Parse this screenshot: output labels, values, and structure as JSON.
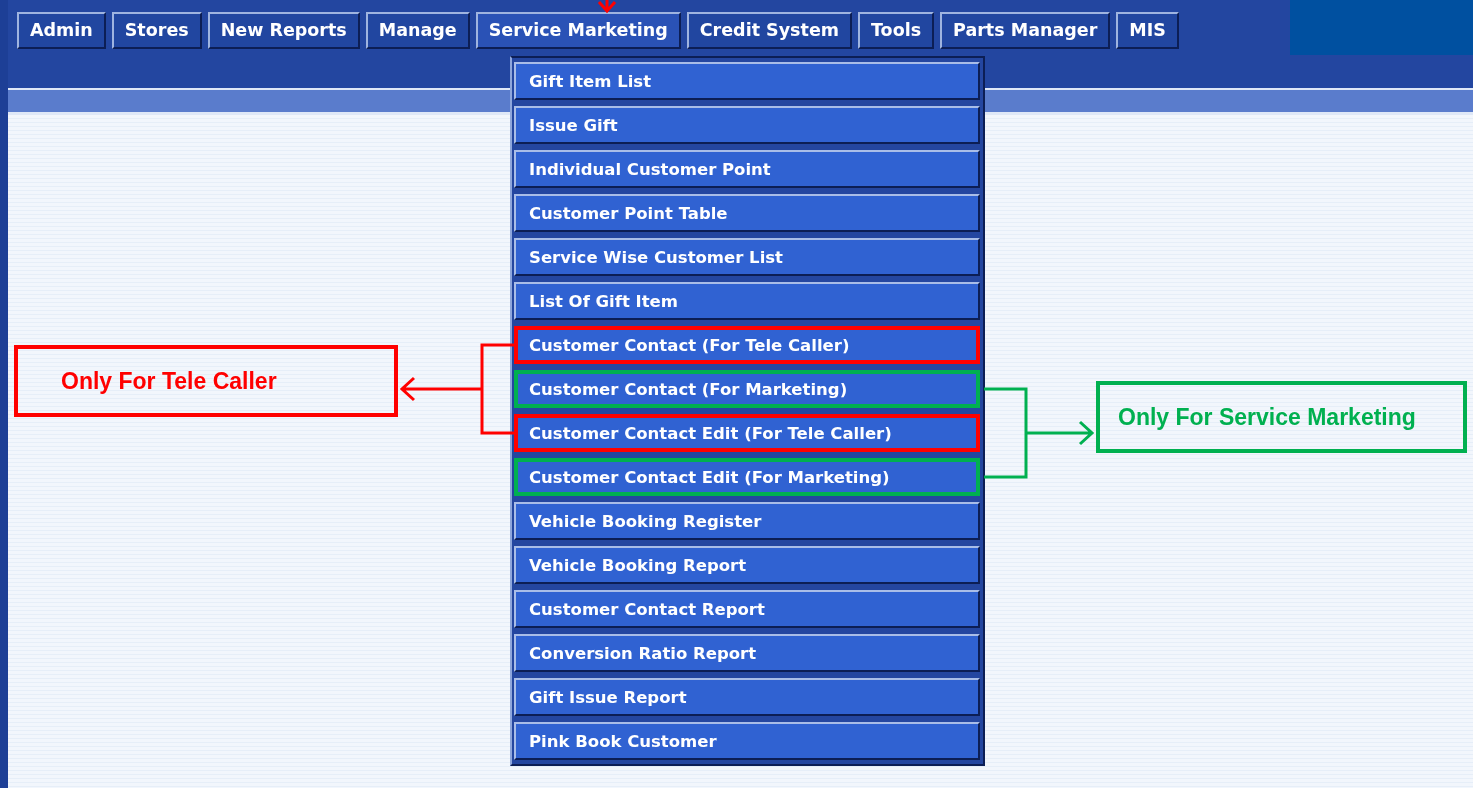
{
  "menu_bar": [
    {
      "label": "Admin",
      "selected": false
    },
    {
      "label": "Stores",
      "selected": false
    },
    {
      "label": "New Reports",
      "selected": false
    },
    {
      "label": "Manage",
      "selected": false
    },
    {
      "label": "Service Marketing",
      "selected": true
    },
    {
      "label": "Credit System",
      "selected": false
    },
    {
      "label": "Tools",
      "selected": false
    },
    {
      "label": "Parts Manager",
      "selected": false
    },
    {
      "label": "MIS",
      "selected": false
    }
  ],
  "dropdown": {
    "items": [
      {
        "label": "Gift Item List"
      },
      {
        "label": "Issue Gift"
      },
      {
        "label": "Individual Customer Point"
      },
      {
        "label": "Customer Point Table"
      },
      {
        "label": "Service Wise Customer List"
      },
      {
        "label": "List Of Gift Item"
      },
      {
        "label": "Customer Contact (For Tele Caller)",
        "color": "#ff0000"
      },
      {
        "label": "Customer Contact (For Marketing)",
        "color": "#00b050"
      },
      {
        "label": "Customer Contact Edit (For Tele Caller)",
        "color": "#ff0000"
      },
      {
        "label": "Customer Contact Edit (For Marketing)",
        "color": "#00b050"
      },
      {
        "label": "Vehicle Booking Register"
      },
      {
        "label": "Vehicle Booking Report"
      },
      {
        "label": "Customer Contact Report"
      },
      {
        "label": "Conversion Ratio Report"
      },
      {
        "label": "Gift Issue Report"
      },
      {
        "label": "Pink Book Customer"
      }
    ]
  },
  "annotations": [
    {
      "label": "Only For Tele Caller",
      "color": "#ff0000"
    },
    {
      "label": "Only For Service Marketing",
      "color": "#00b050"
    }
  ]
}
